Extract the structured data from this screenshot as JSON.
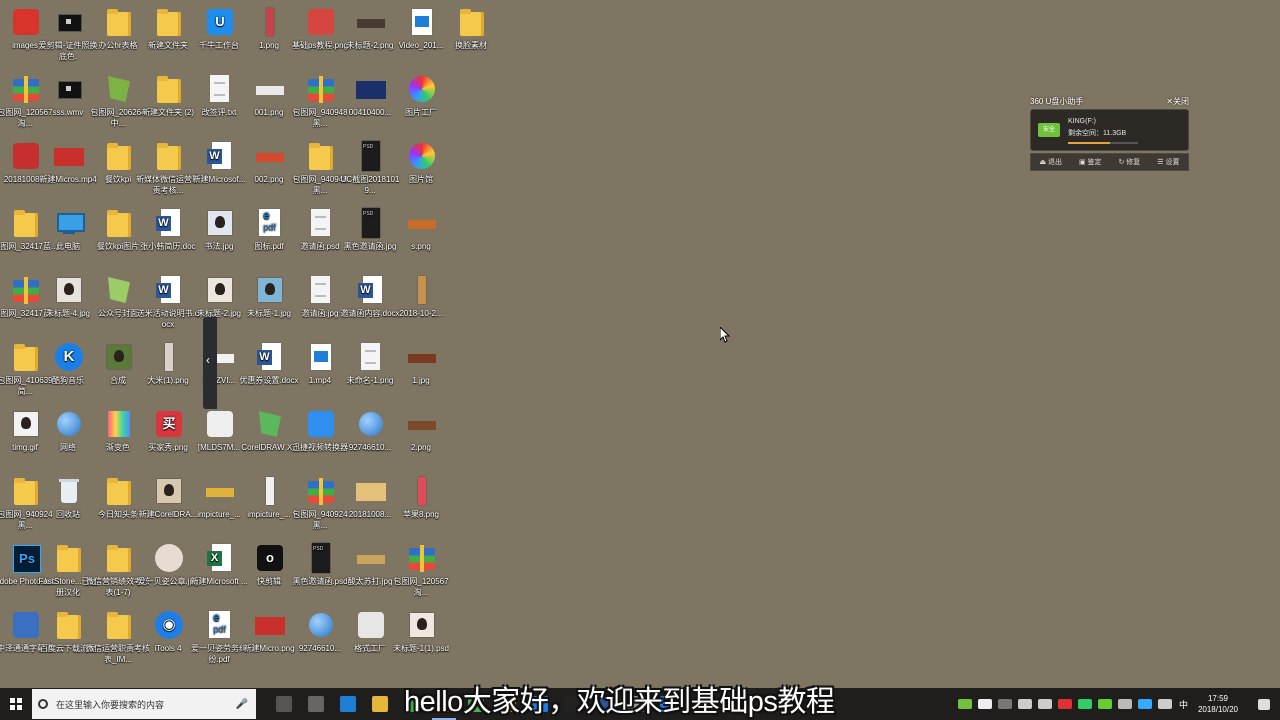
{
  "desktop_icons": [
    {
      "label": "images",
      "kind": "app",
      "c": "#d8342c",
      "t": ""
    },
    {
      "label": "爱剪辑-证件照换底色.",
      "kind": "black"
    },
    {
      "label": "办公hr表格",
      "kind": "folder"
    },
    {
      "label": "新建文件夹",
      "kind": "folder"
    },
    {
      "label": "千牛工作台",
      "kind": "app",
      "c": "#1d8ef0",
      "t": "U"
    },
    {
      "label": "1.png",
      "kind": "tall",
      "c": "#c7434b"
    },
    {
      "label": "基础ps教程.png",
      "kind": "app",
      "c": "#d4463f",
      "t": ""
    },
    {
      "label": "未标题-2.png",
      "kind": "strip",
      "c": "#4a3b32"
    },
    {
      "label": "Video_201...",
      "kind": "video"
    },
    {
      "label": "换脸素材",
      "kind": "folder"
    },
    {
      "label": "包图网_120567淘...",
      "kind": "zip"
    },
    {
      "label": "sss.wmv",
      "kind": "black"
    },
    {
      "label": "包图网_206264中...",
      "kind": "green",
      "c": "#7cb342"
    },
    {
      "label": "新建文件夹 (2)",
      "kind": "folder"
    },
    {
      "label": "改签评.txt",
      "kind": "doc"
    },
    {
      "label": "001.png",
      "kind": "strip",
      "c": "#e9e9e9"
    },
    {
      "label": "包图网_940948黑...",
      "kind": "zip"
    },
    {
      "label": "00410400...",
      "kind": "wide",
      "c": "#1b2f6a"
    },
    {
      "label": "图片工厂",
      "kind": "palette"
    },
    {
      "label": "20181008...",
      "kind": "app",
      "c": "#c62f2f",
      "t": ""
    },
    {
      "label": "新建Micros.mp4",
      "kind": "wide",
      "c": "#c9302c"
    },
    {
      "label": "餐饮kpi",
      "kind": "folder"
    },
    {
      "label": "新媒体微信运营职责考核...",
      "kind": "folder"
    },
    {
      "label": "新建Microsof...",
      "kind": "word"
    },
    {
      "label": "002.png",
      "kind": "strip",
      "c": "#d54a2d"
    },
    {
      "label": "包图网_940948黑...",
      "kind": "folder"
    },
    {
      "label": "UC截图20181019...",
      "kind": "dark"
    },
    {
      "label": "图片馆",
      "kind": "palette"
    },
    {
      "label": "包图网_32417蓝...",
      "kind": "folder"
    },
    {
      "label": "此电脑",
      "kind": "computer"
    },
    {
      "label": "餐饮kpi图片",
      "kind": "folder"
    },
    {
      "label": "张小韩简历.doc",
      "kind": "word"
    },
    {
      "label": "书法.jpg",
      "kind": "photo",
      "c": "#dfe6ef"
    },
    {
      "label": "图标.pdf",
      "kind": "pdf"
    },
    {
      "label": "邀请函.psd",
      "kind": "doc"
    },
    {
      "label": "黑色邀请函.jpg",
      "kind": "dark"
    },
    {
      "label": "s.png",
      "kind": "strip",
      "c": "#c96b2a"
    },
    {
      "label": "包图网_32417蓝...",
      "kind": "zip"
    },
    {
      "label": "未标题-4.jpg",
      "kind": "photo",
      "c": "#e8e2dc"
    },
    {
      "label": "公众号封面",
      "kind": "green",
      "c": "#9ccc65"
    },
    {
      "label": "送米活动说明书.docx",
      "kind": "word"
    },
    {
      "label": "未标题-2.jpg",
      "kind": "photo",
      "c": "#ece6de"
    },
    {
      "label": "未标题-1.jpg",
      "kind": "photo",
      "c": "#7fb6d8"
    },
    {
      "label": "邀请函.jpg",
      "kind": "doc"
    },
    {
      "label": "邀请函内容.docx",
      "kind": "word"
    },
    {
      "label": "2018-10-2...",
      "kind": "tall",
      "c": "#c9914e"
    },
    {
      "label": "包图网_410639简...",
      "kind": "folder"
    },
    {
      "label": "酷狗音乐",
      "kind": "round",
      "c": "#1a7fe6",
      "t": "K"
    },
    {
      "label": "合成",
      "kind": "photo",
      "c": "#5a7a3a"
    },
    {
      "label": "大米(1).png",
      "kind": "tall",
      "c": "#d9d2c8"
    },
    {
      "label": "X\"FZVI...",
      "kind": "strip",
      "c": "#f2f2f2"
    },
    {
      "label": "优惠券设置.docx",
      "kind": "word"
    },
    {
      "label": "1.mp4",
      "kind": "video"
    },
    {
      "label": "未命名-1.png",
      "kind": "doc"
    },
    {
      "label": "1.jpg",
      "kind": "strip",
      "c": "#7a3a22"
    },
    {
      "label": "timg.gif",
      "kind": "photo",
      "c": "#f3f3f3"
    },
    {
      "label": "网络",
      "kind": "globe"
    },
    {
      "label": "渐变色",
      "kind": "grad"
    },
    {
      "label": "买家秀.png",
      "kind": "app",
      "c": "#d9363e",
      "t": "买"
    },
    {
      "label": "[MLDS7M...",
      "kind": "app",
      "c": "#efefef",
      "t": ""
    },
    {
      "label": "CorelDRAW X7",
      "kind": "green",
      "c": "#5cb85c"
    },
    {
      "label": "迅捷视频转换器",
      "kind": "app",
      "c": "#2f8ff0",
      "t": ""
    },
    {
      "label": "92746610...",
      "kind": "globe"
    },
    {
      "label": "2.png",
      "kind": "strip",
      "c": "#7a4a2a"
    },
    {
      "label": "包图网_940924黑...",
      "kind": "folder"
    },
    {
      "label": "回收站",
      "kind": "bin"
    },
    {
      "label": "今日知头条",
      "kind": "folder"
    },
    {
      "label": "新建CorelDRA...",
      "kind": "photo",
      "c": "#d8c8b0"
    },
    {
      "label": "impicture_...",
      "kind": "strip",
      "c": "#e0b23a"
    },
    {
      "label": "impicture_...",
      "kind": "tall",
      "c": "#f0f0f0"
    },
    {
      "label": "包图网_940924黑...",
      "kind": "zip"
    },
    {
      "label": "20181008...",
      "kind": "wide",
      "c": "#e4c07a"
    },
    {
      "label": "苹果8.png",
      "kind": "tall",
      "c": "#e14a5a"
    },
    {
      "label": "Adobe Photosh...",
      "kind": "ps"
    },
    {
      "label": "FastStone...已注册汉化",
      "kind": "folder"
    },
    {
      "label": "微信营销绩效考核表(1-7)",
      "kind": "folder"
    },
    {
      "label": "爱一贝姿公章.jpg",
      "kind": "round",
      "c": "#e8dcd2",
      "t": ""
    },
    {
      "label": "新建Microsoft ...",
      "kind": "excel"
    },
    {
      "label": "快剪辑",
      "kind": "app",
      "c": "#111",
      "t": "o"
    },
    {
      "label": "黑色邀请函.psd",
      "kind": "dark"
    },
    {
      "label": "酸太苏打.jpg",
      "kind": "strip",
      "c": "#c9a45a"
    },
    {
      "label": "包图网_120567淘...",
      "kind": "zip"
    },
    {
      "label": "中泽通通字幕通",
      "kind": "app",
      "c": "#3b6fc2",
      "t": ""
    },
    {
      "label": "百度云下载流程",
      "kind": "folder"
    },
    {
      "label": "微信运营职责考核表_IM...",
      "kind": "folder"
    },
    {
      "label": "iTools 4",
      "kind": "round",
      "c": "#1e7ee8",
      "t": "◉"
    },
    {
      "label": "爱一贝姿劳务纠纷.pdf",
      "kind": "pdf"
    },
    {
      "label": "新建Micro.png",
      "kind": "wide",
      "c": "#c9302c"
    },
    {
      "label": "92746610...",
      "kind": "globe"
    },
    {
      "label": "格式工厂",
      "kind": "app",
      "c": "#e6e6e6",
      "t": ""
    },
    {
      "label": "未标题-1(1).psd",
      "kind": "photo",
      "c": "#f2e6e0"
    }
  ],
  "widget_360": {
    "title": "360 U盘小助手",
    "close_label": "✕关闭",
    "drive_badge": "安全",
    "drive_name": "KING(F:)",
    "free_space": "剩余空间：11.3GB",
    "used_fraction": 0.6,
    "actions": [
      "⏏ 退出",
      "▣ 鉴定",
      "↻ 修复",
      "☰ 设置"
    ]
  },
  "subtitle": "hello大家好，欢迎来到基础ps教程",
  "taskbar": {
    "search_placeholder": "在这里输入你要搜索的内容",
    "pinned": [
      {
        "name": "task-view-icon",
        "c": "#555"
      },
      {
        "name": "app-icon-1",
        "c": "#666"
      },
      {
        "name": "edge-icon",
        "c": "#1f7fd6"
      },
      {
        "name": "file-explorer-icon",
        "c": "#e8b63d"
      },
      {
        "name": "app-icon-2",
        "c": "#3fae49"
      },
      {
        "name": "app-icon-3",
        "c": "#e8772e"
      },
      {
        "name": "app-icon-4",
        "c": "#4caf50"
      },
      {
        "name": "app-icon-5",
        "c": "#f0a030"
      },
      {
        "name": "app-icon-6",
        "c": "#1e7ee8"
      },
      {
        "name": "app-icon-7",
        "c": "#222"
      },
      {
        "name": "app-icon-8",
        "c": "#2b579a"
      },
      {
        "name": "app-icon-9",
        "c": "#999"
      },
      {
        "name": "app-icon-10",
        "c": "#1e7ee8"
      }
    ],
    "tray_icons": [
      {
        "name": "battery-icon",
        "c": "#6fc23b"
      },
      {
        "name": "m-app-icon",
        "c": "#eee"
      },
      {
        "name": "user-icon",
        "c": "#777"
      },
      {
        "name": "people-icon",
        "c": "#ccc"
      },
      {
        "name": "chevron-up-icon",
        "c": "#ccc"
      },
      {
        "name": "tray-app-1",
        "c": "#d33"
      },
      {
        "name": "tray-app-2",
        "c": "#3c6"
      },
      {
        "name": "tray-app-3",
        "c": "#6c3"
      },
      {
        "name": "tray-app-4",
        "c": "#bbb"
      },
      {
        "name": "tray-app-5",
        "c": "#3af"
      },
      {
        "name": "volume-icon",
        "c": "#ccc"
      }
    ],
    "ime": "中",
    "time": "17:59",
    "date": "2018/10/20"
  }
}
